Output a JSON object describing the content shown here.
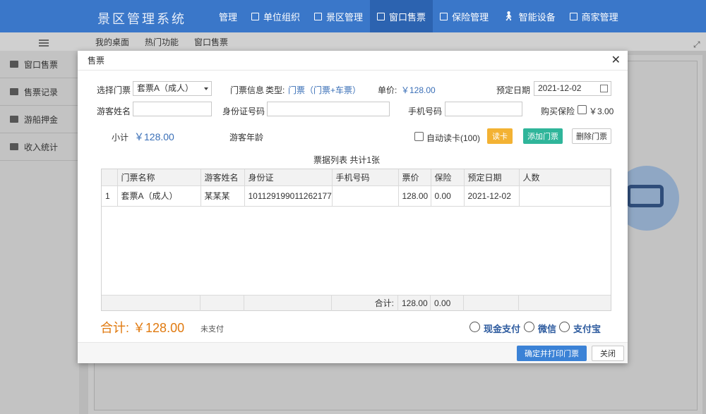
{
  "app": {
    "title": "景区管理系统"
  },
  "topnav": [
    {
      "label": "管理",
      "icon": "grid-icon"
    },
    {
      "label": "单位组织",
      "icon": "org-icon"
    },
    {
      "label": "景区管理",
      "icon": "scenic-icon"
    },
    {
      "label": "窗口售票",
      "icon": "ticket-window-icon",
      "active": true
    },
    {
      "label": "保险管理",
      "icon": "folder-icon"
    },
    {
      "label": "智能设备",
      "icon": "person-icon"
    },
    {
      "label": "商家管理",
      "icon": "shop-icon"
    }
  ],
  "tabs": [
    "我的桌面",
    "热门功能",
    "窗口售票"
  ],
  "sidebar": [
    {
      "label": "窗口售票"
    },
    {
      "label": "售票记录"
    },
    {
      "label": "游船押金"
    },
    {
      "label": "收入统计"
    }
  ],
  "modal": {
    "title": "售票",
    "select_ticket_label": "选择门票",
    "select_ticket_value": "套票A（成人）",
    "ticket_info_label": "门票信息",
    "type_label": "类型:",
    "type_value": "门票（门票+车票）",
    "price_label": "单价:",
    "price_value": "￥128.00",
    "date_label": "预定日期",
    "date_value": "2021-12-02",
    "visitor_name_label": "游客姓名",
    "id_label": "身份证号码",
    "phone_label": "手机号码",
    "insurance_label": "购买保险",
    "insurance_price": "￥3.00",
    "subtotal_label": "小计",
    "subtotal_value": "￥128.00",
    "age_label": "游客年龄",
    "auto_read_label": "自动读卡(100)",
    "read_card_btn": "读卡",
    "add_ticket_btn": "添加门票",
    "delete_ticket_btn": "删除门票",
    "list_caption": "票据列表 共计1张",
    "table": {
      "headers": [
        "",
        "门票名称",
        "游客姓名",
        "身份证",
        "手机号码",
        "票价",
        "保险",
        "预定日期",
        "人数"
      ],
      "rows": [
        [
          "1",
          "套票A（成人）",
          "某某某",
          "101129199011262177",
          "",
          "128.00",
          "0.00",
          "2021-12-02",
          ""
        ]
      ],
      "footer": [
        "",
        "",
        "",
        "",
        "合计:",
        "128.00",
        "0.00",
        "",
        ""
      ]
    },
    "total_label": "合计:",
    "total_value": "￥128.00",
    "unpaid": "未支付",
    "payments": [
      "现金支付",
      "微信",
      "支付宝"
    ],
    "confirm_btn": "确定并打印门票",
    "close_btn": "关闭"
  }
}
